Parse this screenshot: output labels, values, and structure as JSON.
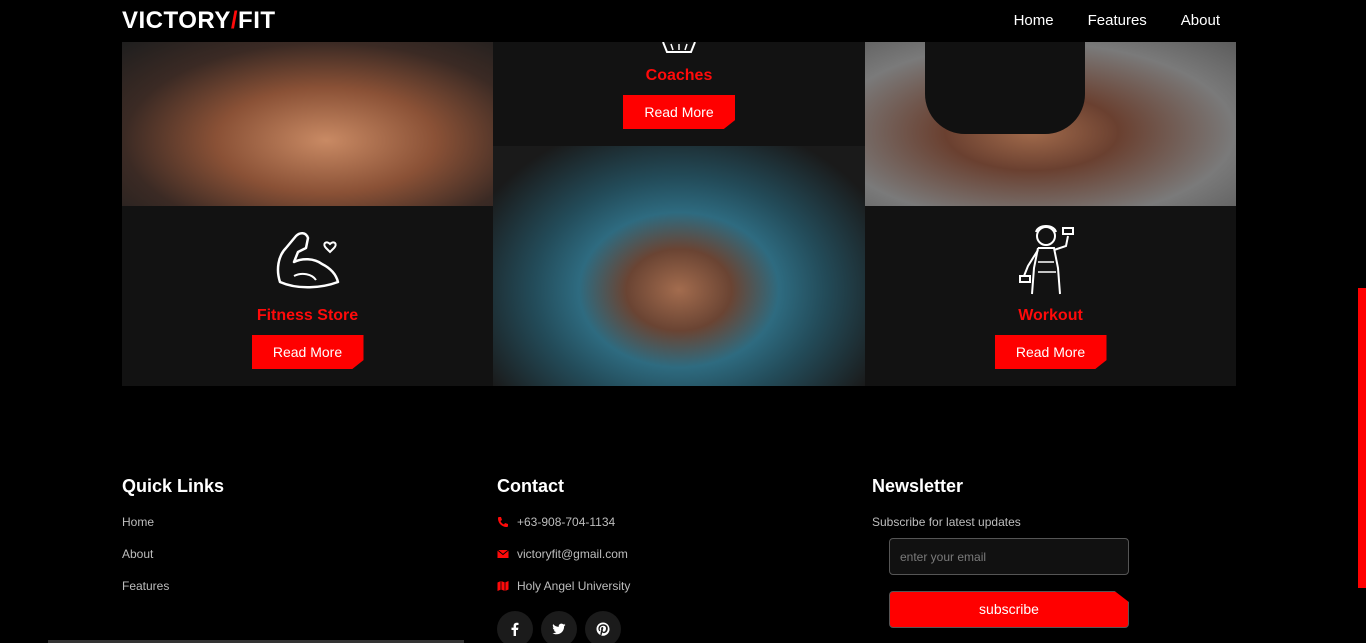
{
  "brand": {
    "name_left": "VICTORY",
    "slash": "/",
    "name_right": "FIT"
  },
  "nav": {
    "home": "Home",
    "features": "Features",
    "about": "About"
  },
  "cards": {
    "coaches": {
      "title": "Coaches",
      "button": "Read More",
      "icon": "dumbbell-basket-icon"
    },
    "store": {
      "title": "Fitness Store",
      "button": "Read More",
      "icon": "flexed-arm-heart-icon"
    },
    "workout": {
      "title": "Workout",
      "button": "Read More",
      "icon": "woman-dumbbell-icon"
    }
  },
  "footer": {
    "quick_links": {
      "heading": "Quick Links",
      "items": [
        "Home",
        "About",
        "Features"
      ]
    },
    "contact": {
      "heading": "Contact",
      "phone": "+63-908-704-1134",
      "email": "victoryfit@gmail.com",
      "location": "Holy Angel University"
    },
    "newsletter": {
      "heading": "Newsletter",
      "subtitle": "Subscribe for latest updates",
      "placeholder": "enter your email",
      "button": "subscribe"
    }
  },
  "colors": {
    "accent": "#ff0000",
    "background": "#000000",
    "card": "#121212"
  }
}
